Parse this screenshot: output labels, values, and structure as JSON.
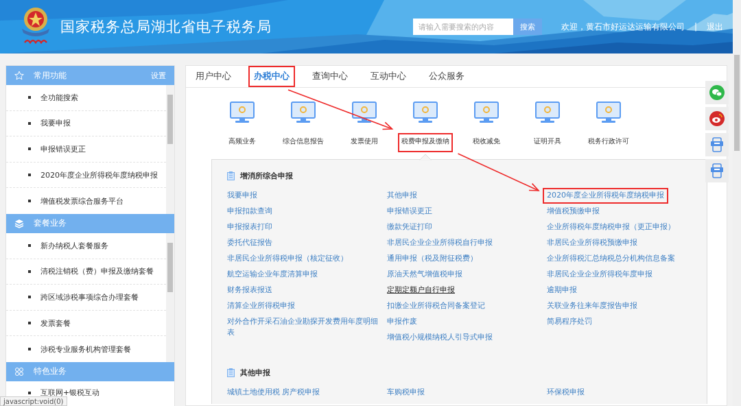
{
  "header": {
    "title": "国家税务总局湖北省电子税务局",
    "search": {
      "placeholder": "请输入需要搜索的内容",
      "button": "搜索"
    },
    "welcome": "欢迎，黄石市好运达运输有限公司",
    "separator": "|",
    "logout": "退出"
  },
  "sidebar": {
    "sections": [
      {
        "title": "常用功能",
        "action": "设置",
        "items": [
          "全功能搜索",
          "我要申报",
          "申报错误更正",
          "2020年度企业所得税年度纳税申报",
          "增值税发票综合服务平台"
        ]
      },
      {
        "title": "套餐业务",
        "items": [
          "新办纳税人套餐服务",
          "清税注销税（费）申报及缴纳套餐",
          "跨区域涉税事项综合办理套餐",
          "发票套餐",
          "涉税专业服务机构管理套餐"
        ]
      },
      {
        "title": "特色业务",
        "items": [
          "互联网+银税互动"
        ]
      }
    ]
  },
  "tabs": [
    {
      "label": "用户中心",
      "selected": false,
      "highlighted": false
    },
    {
      "label": "办税中心",
      "selected": true,
      "highlighted": true
    },
    {
      "label": "查询中心",
      "selected": false,
      "highlighted": false
    },
    {
      "label": "互动中心",
      "selected": false,
      "highlighted": false
    },
    {
      "label": "公众服务",
      "selected": false,
      "highlighted": false
    }
  ],
  "categories": [
    {
      "label": "高频业务",
      "selected": false,
      "highlighted": false
    },
    {
      "label": "综合信息报告",
      "selected": false,
      "highlighted": false
    },
    {
      "label": "发票使用",
      "selected": false,
      "highlighted": false
    },
    {
      "label": "税费申报及缴纳",
      "selected": true,
      "highlighted": true
    },
    {
      "label": "税收减免",
      "selected": false,
      "highlighted": false
    },
    {
      "label": "证明开具",
      "selected": false,
      "highlighted": false
    },
    {
      "label": "税务行政许可",
      "selected": false,
      "highlighted": false
    }
  ],
  "groups": [
    {
      "title": "增消所综合申报",
      "columns": [
        [
          {
            "label": "我要申报",
            "hovered": false,
            "highlighted": false
          },
          {
            "label": "申报扣款查询",
            "hovered": false,
            "highlighted": false
          },
          {
            "label": "申报报表打印",
            "hovered": false,
            "highlighted": false
          },
          {
            "label": "委托代征报告",
            "hovered": false,
            "highlighted": false
          },
          {
            "label": "非居民企业所得税申报（核定征收）",
            "hovered": false,
            "highlighted": false
          },
          {
            "label": "航空运输企业年度清算申报",
            "hovered": false,
            "highlighted": false
          },
          {
            "label": "财务报表报送",
            "hovered": false,
            "highlighted": false
          },
          {
            "label": "清算企业所得税申报",
            "hovered": false,
            "highlighted": false
          },
          {
            "label": "对外合作开采石油企业勘探开发费用年度明细表",
            "hovered": false,
            "highlighted": false
          }
        ],
        [
          {
            "label": "其他申报",
            "hovered": false,
            "highlighted": false
          },
          {
            "label": "申报错误更正",
            "hovered": false,
            "highlighted": false
          },
          {
            "label": "缴款凭证打印",
            "hovered": false,
            "highlighted": false
          },
          {
            "label": "非居民企业企业所得税自行申报",
            "hovered": false,
            "highlighted": false
          },
          {
            "label": "通用申报（税及附征税费）",
            "hovered": false,
            "highlighted": false
          },
          {
            "label": "原油天然气增值税申报",
            "hovered": false,
            "highlighted": false
          },
          {
            "label": "定期定额户自行申报",
            "hovered": true,
            "highlighted": false
          },
          {
            "label": "扣缴企业所得税合同备案登记",
            "hovered": false,
            "highlighted": false
          },
          {
            "label": "申报作废",
            "hovered": false,
            "highlighted": false
          },
          {
            "label": "增值税小规模纳税人引导式申报",
            "hovered": false,
            "highlighted": false
          }
        ],
        [
          {
            "label": "2020年度企业所得税年度纳税申报",
            "hovered": false,
            "highlighted": true
          },
          {
            "label": "增值税预缴申报",
            "hovered": false,
            "highlighted": false
          },
          {
            "label": "企业所得税年度纳税申报（更正申报）",
            "hovered": false,
            "highlighted": false
          },
          {
            "label": "非居民企业所得税预缴申报",
            "hovered": false,
            "highlighted": false
          },
          {
            "label": "企业所得税汇总纳税总分机构信息备案",
            "hovered": false,
            "highlighted": false
          },
          {
            "label": "非居民企业企业所得税年度申报",
            "hovered": false,
            "highlighted": false
          },
          {
            "label": "逾期申报",
            "hovered": false,
            "highlighted": false
          },
          {
            "label": "关联业务往来年度报告申报",
            "hovered": false,
            "highlighted": false
          },
          {
            "label": "简易程序处罚",
            "hovered": false,
            "highlighted": false
          }
        ]
      ]
    },
    {
      "title": "其他申报",
      "columns": [
        [
          {
            "label": "城镇土地使用税 房产税申报",
            "hovered": false,
            "highlighted": false
          }
        ],
        [
          {
            "label": "车购税申报",
            "hovered": false,
            "highlighted": false
          }
        ],
        [
          {
            "label": "环保税申报",
            "hovered": false,
            "highlighted": false
          }
        ]
      ]
    }
  ],
  "float_buttons": [
    {
      "kind": "wechat"
    },
    {
      "kind": "weibo"
    },
    {
      "kind": "app"
    },
    {
      "kind": "app"
    }
  ],
  "status_link": "javascript:void(0)"
}
